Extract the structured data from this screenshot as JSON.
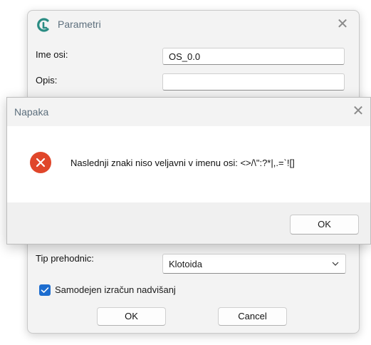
{
  "parameters_dialog": {
    "title": "Parametri",
    "close_icon": "close-icon",
    "axis_name_label": "Ime osi:",
    "axis_name_value": "OS_0.0",
    "description_label": "Opis:",
    "description_value": "",
    "transition_type_label": "Tip prehodnic:",
    "transition_type_value": "Klotoida",
    "auto_superelevation_label": "Samodejen izračun nadvišanj",
    "auto_superelevation_checked": true,
    "ok_label": "OK",
    "cancel_label": "Cancel"
  },
  "error_dialog": {
    "title": "Napaka",
    "icon": "error-icon",
    "message": "Naslednji znaki niso veljavni v imenu osi: <>/\\\":?*|,.=`![]",
    "ok_label": "OK"
  },
  "colors": {
    "error_icon": "#e0462a",
    "checkbox_accent": "#1d6dcf",
    "logo_accent": "#2a8c83"
  }
}
